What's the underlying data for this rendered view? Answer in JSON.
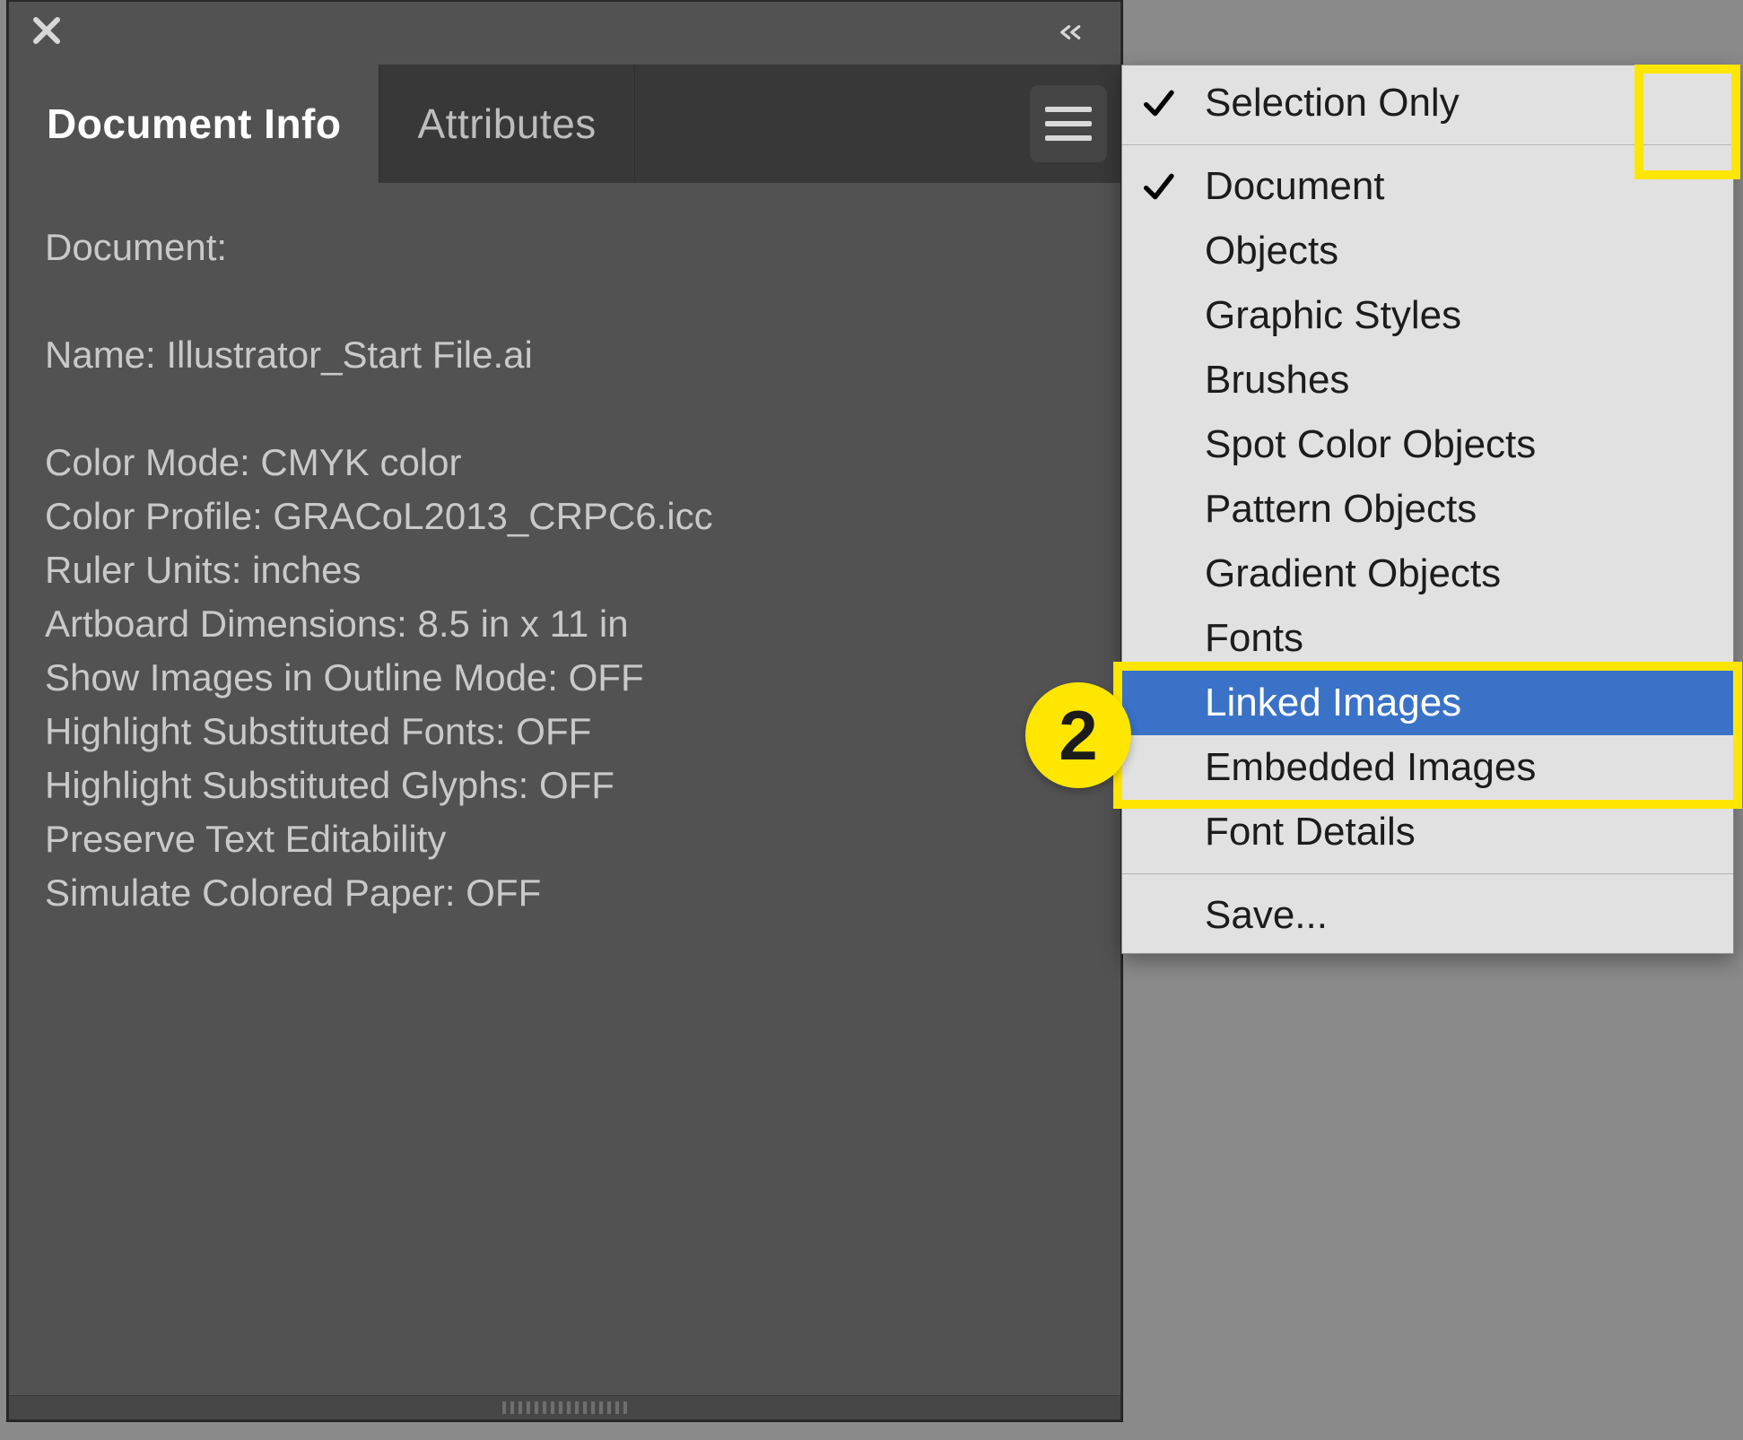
{
  "panel": {
    "tabs": {
      "doc_info": "Document Info",
      "attributes": "Attributes"
    },
    "body": {
      "heading": "Document:",
      "name_line": "Name: Illustrator_Start File.ai",
      "color_mode": "Color Mode: CMYK color",
      "color_profile": "Color Profile: GRACoL2013_CRPC6.icc",
      "ruler_units": "Ruler Units: inches",
      "artboard_dims": "Artboard Dimensions: 8.5 in x 11 in",
      "show_images_outline": "Show Images in Outline Mode: OFF",
      "hl_sub_fonts": "Highlight Substituted Fonts: OFF",
      "hl_sub_glyphs": "Highlight Substituted Glyphs: OFF",
      "preserve_text": "Preserve Text Editability",
      "sim_colored_paper": "Simulate Colored Paper: OFF"
    }
  },
  "flyout": {
    "selection_only": "Selection Only",
    "document": "Document",
    "objects": "Objects",
    "graphic_styles": "Graphic Styles",
    "brushes": "Brushes",
    "spot_color_objects": "Spot Color Objects",
    "pattern_objects": "Pattern Objects",
    "gradient_objects": "Gradient Objects",
    "fonts": "Fonts",
    "linked_images": "Linked Images",
    "embedded_images": "Embedded Images",
    "font_details": "Font Details",
    "save": "Save..."
  },
  "annotations": {
    "step_number": "2"
  }
}
